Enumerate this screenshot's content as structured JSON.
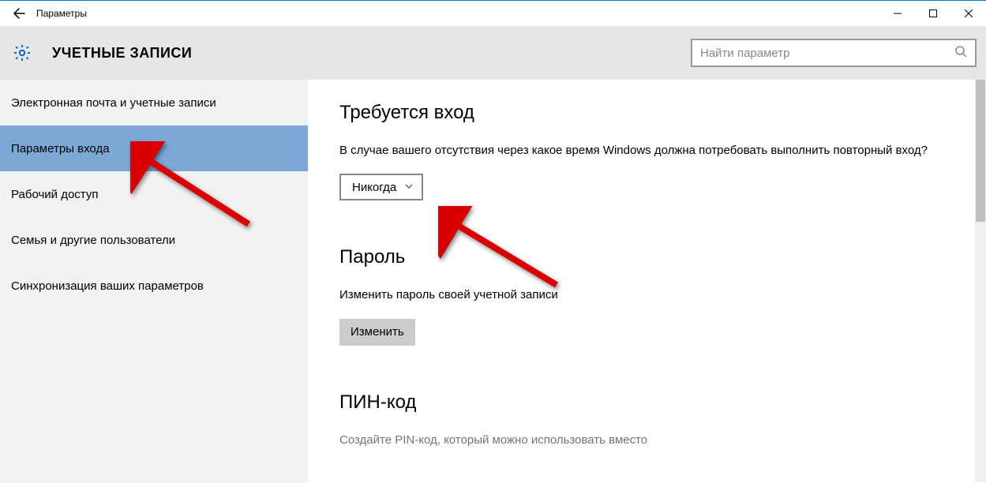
{
  "window": {
    "title": "Параметры"
  },
  "header": {
    "heading": "УЧЕТНЫЕ ЗАПИСИ",
    "search_placeholder": "Найти параметр"
  },
  "sidebar": {
    "items": [
      {
        "label": "Электронная почта и учетные записи",
        "selected": false
      },
      {
        "label": "Параметры входа",
        "selected": true
      },
      {
        "label": "Рабочий доступ",
        "selected": false
      },
      {
        "label": "Семья и другие пользователи",
        "selected": false
      },
      {
        "label": "Синхронизация ваших параметров",
        "selected": false
      }
    ]
  },
  "content": {
    "signin_required": {
      "heading": "Требуется вход",
      "description": "В случае вашего отсутствия через какое время Windows должна потребовать выполнить повторный вход?",
      "dropdown_value": "Никогда"
    },
    "password": {
      "heading": "Пароль",
      "description": "Изменить пароль своей учетной записи",
      "button": "Изменить"
    },
    "pin": {
      "heading": "ПИН-код",
      "description": "Создайте PIN-код, который можно использовать вместо"
    }
  }
}
